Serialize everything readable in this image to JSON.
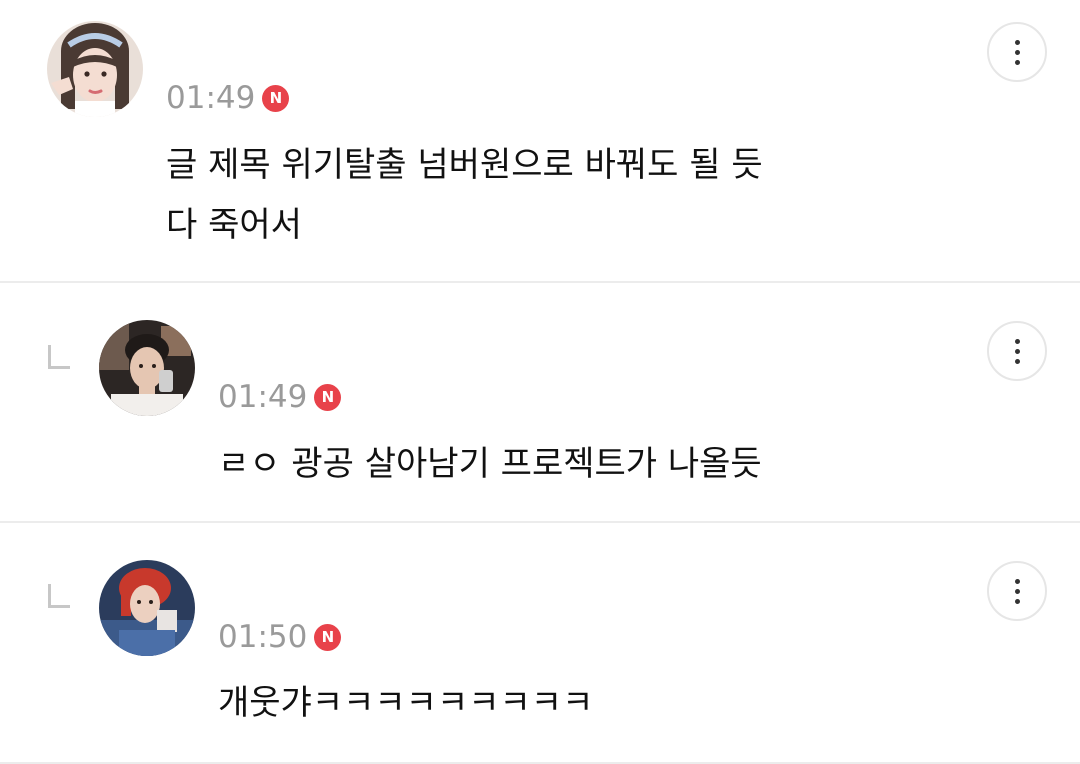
{
  "comments": [
    {
      "time": "01:49",
      "badge": "N",
      "lines": [
        "글 제목 위기탈출 넘버원으로 바꿔도 될 듯",
        "다 죽어서"
      ],
      "is_reply": false,
      "avatar_icon": "user-avatar"
    },
    {
      "time": "01:49",
      "badge": "N",
      "lines": [
        "ㄹㅇ 광공 살아남기 프로젝트가 나올듯"
      ],
      "is_reply": true,
      "avatar_icon": "user-avatar"
    },
    {
      "time": "01:50",
      "badge": "N",
      "lines": [
        "개웃갸ㅋㅋㅋㅋㅋㅋㅋㅋㅋ"
      ],
      "is_reply": true,
      "avatar_icon": "user-avatar"
    }
  ],
  "icons": {
    "menu": "more-vertical-icon",
    "reply": "reply-corner-icon",
    "new_badge": "new-badge-icon"
  },
  "colors": {
    "badge": "#e8424a",
    "time": "#9a9a9a",
    "divider": "#ececec"
  }
}
